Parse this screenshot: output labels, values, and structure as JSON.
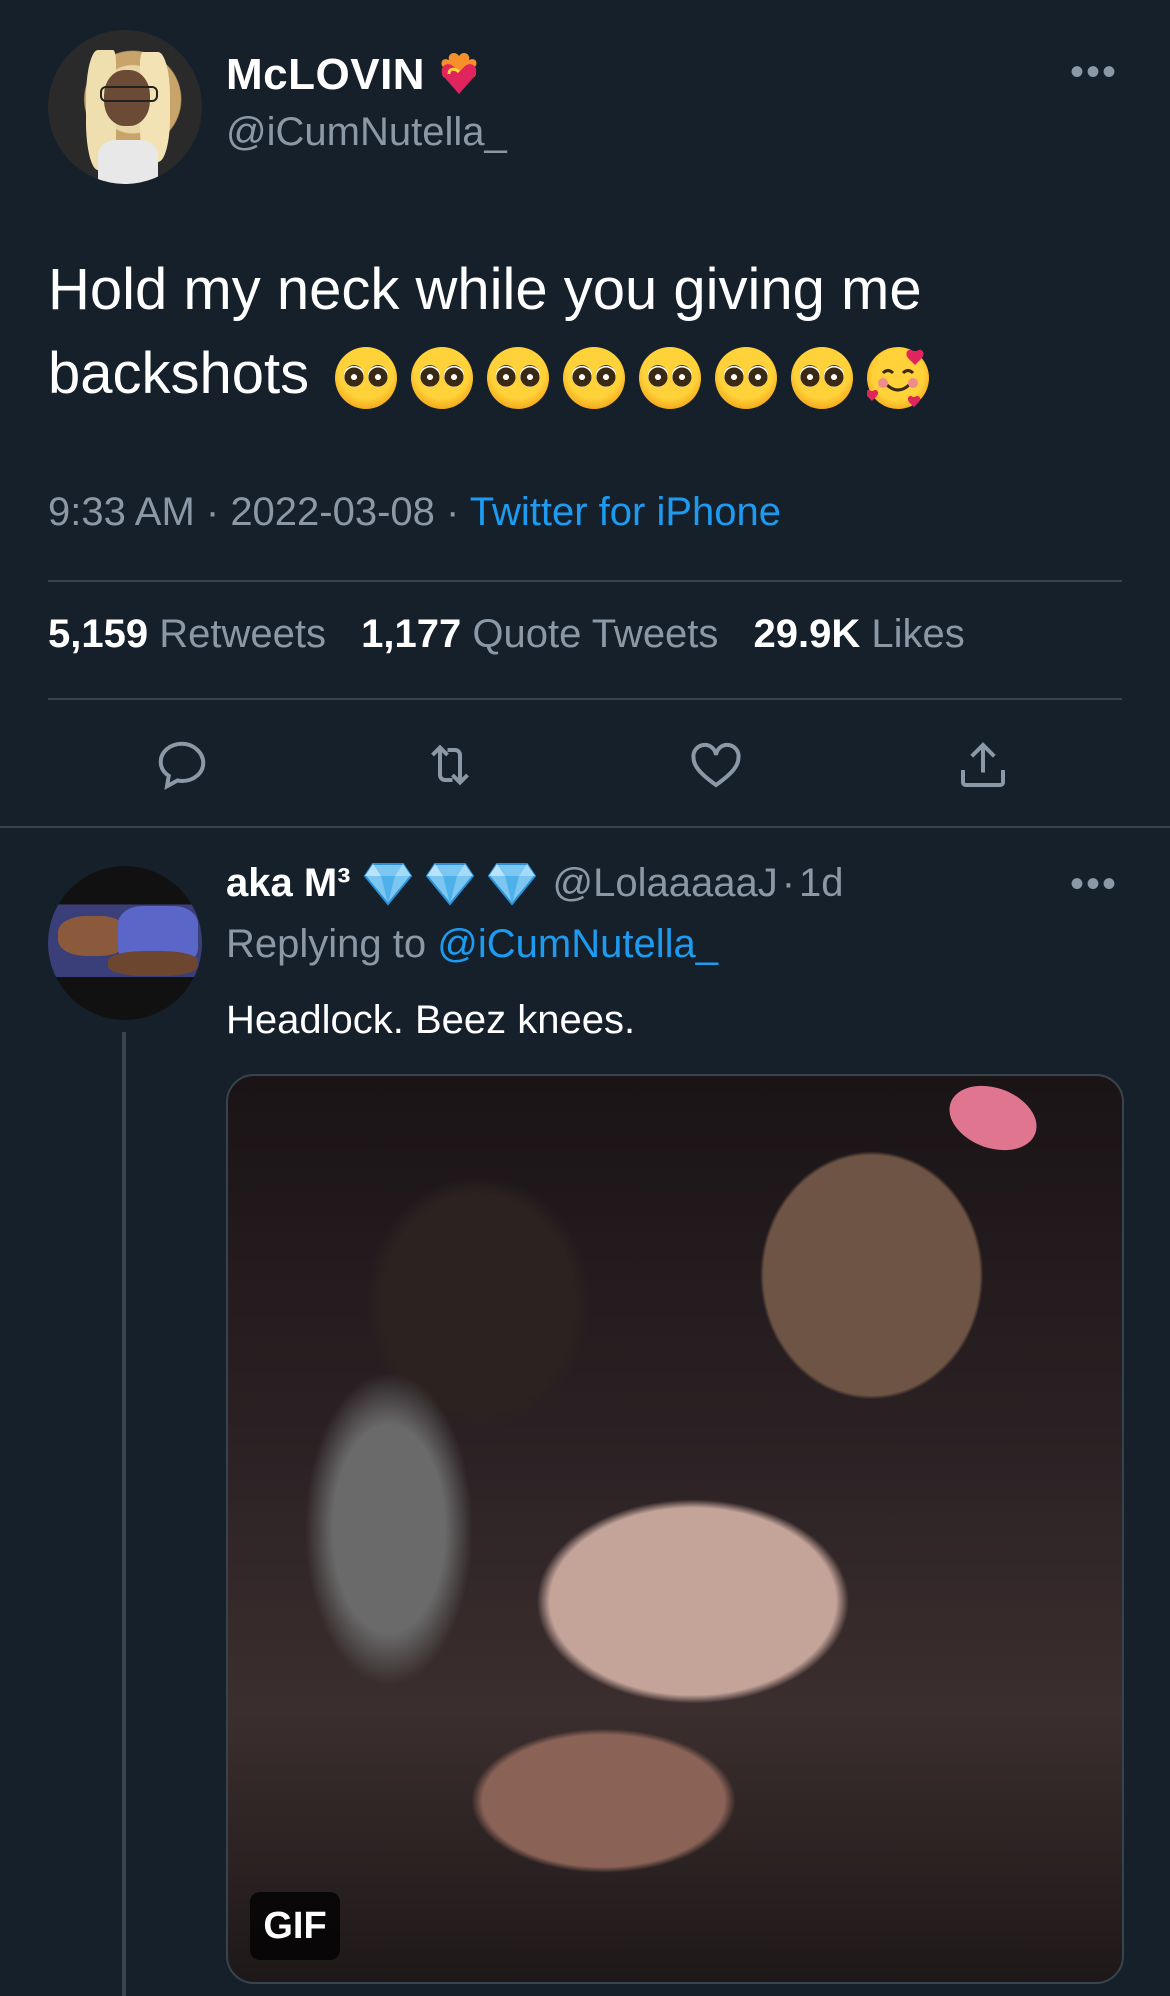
{
  "tweet": {
    "author_name": "McLOVIN",
    "author_handle": "@iCumNutella_",
    "text": "Hold my neck while you giving me backshots",
    "emojis": [
      "pleading-face",
      "pleading-face",
      "pleading-face",
      "pleading-face",
      "pleading-face",
      "pleading-face",
      "pleading-face",
      "smiling-face-with-hearts"
    ],
    "time": "9:33 AM",
    "date": "2022-03-08",
    "separator": " · ",
    "source": "Twitter for iPhone",
    "stats": {
      "retweets_count": "5,159",
      "retweets_label": "Retweets",
      "quotes_count": "1,177",
      "quotes_label": "Quote Tweets",
      "likes_count": "29.9K",
      "likes_label": "Likes"
    },
    "actions": [
      "reply-icon",
      "retweet-icon",
      "like-icon",
      "share-icon"
    ]
  },
  "reply": {
    "author_name": "aka M³",
    "author_handle": "@LolaaaaaJ",
    "age": "1d",
    "badges": [
      "gem-icon",
      "gem-icon",
      "gem-icon"
    ],
    "replying_prefix": "Replying to",
    "replying_to": "@iCumNutella_",
    "text": "Headlock. Beez knees.",
    "media_badge": "GIF"
  },
  "colors": {
    "background": "#15202b",
    "text": "#ffffff",
    "secondary": "#8b98a5",
    "link": "#1d9bf0",
    "divider": "#38444d"
  }
}
